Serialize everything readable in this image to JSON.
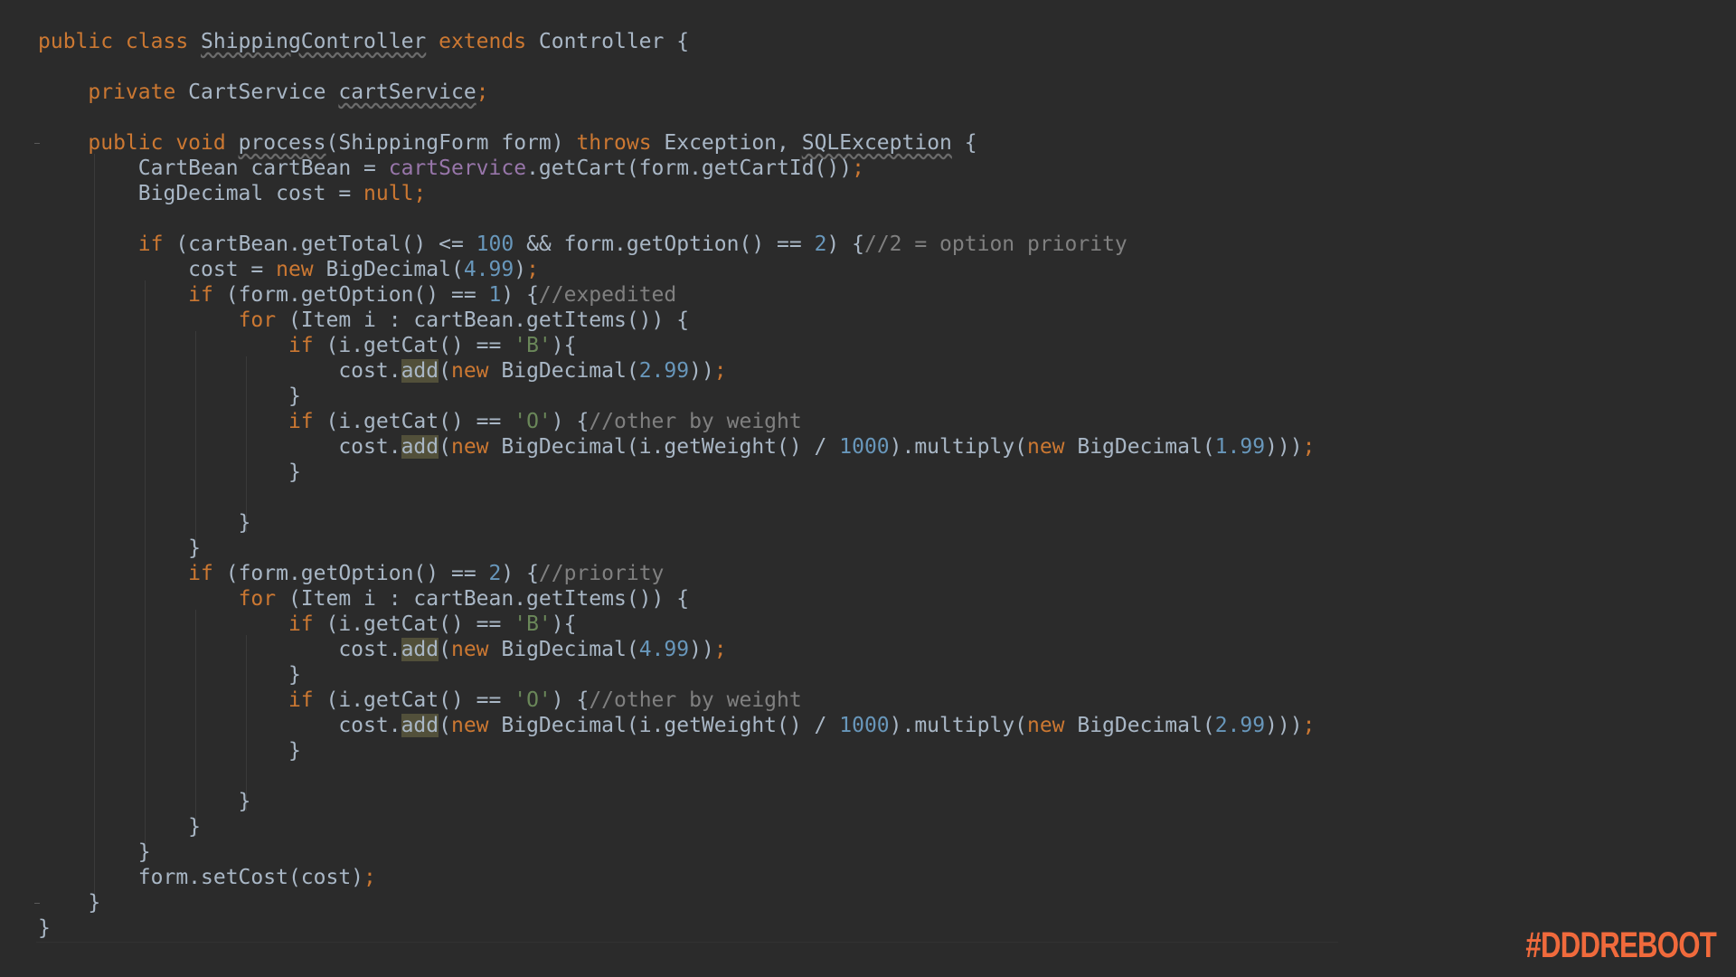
{
  "editor": {
    "lines": [
      [
        [
          "kw",
          "public class "
        ],
        [
          "dim",
          "ShippingController"
        ],
        [
          "kw",
          " extends "
        ],
        [
          "ty",
          "Controller {"
        ]
      ],
      [],
      [
        [
          "ty",
          "    "
        ],
        [
          "kw",
          "private "
        ],
        [
          "ty",
          "CartService "
        ],
        [
          "dim",
          "cartService"
        ],
        [
          "kw",
          ";"
        ]
      ],
      [],
      [
        [
          "ty",
          "    "
        ],
        [
          "kw",
          "public void "
        ],
        [
          "dim",
          "process"
        ],
        [
          "ty",
          "(ShippingForm form) "
        ],
        [
          "kw",
          "throws "
        ],
        [
          "ty",
          "Exception, "
        ],
        [
          "dim",
          "SQLException"
        ],
        [
          "ty",
          " {"
        ]
      ],
      [
        [
          "ty",
          "        CartBean cartBean = "
        ],
        [
          "fld",
          "cartService"
        ],
        [
          "ty",
          ".getCart(form.getCartId())"
        ],
        [
          "kw",
          ";"
        ]
      ],
      [
        [
          "ty",
          "        BigDecimal cost = "
        ],
        [
          "kw",
          "null;"
        ]
      ],
      [],
      [
        [
          "ty",
          "        "
        ],
        [
          "kw",
          "if "
        ],
        [
          "ty",
          "(cartBean.getTotal() <= "
        ],
        [
          "num",
          "100"
        ],
        [
          "ty",
          " && form.getOption() == "
        ],
        [
          "num",
          "2"
        ],
        [
          "ty",
          ") {"
        ],
        [
          "cm",
          "//2 = option priority"
        ]
      ],
      [
        [
          "ty",
          "            cost = "
        ],
        [
          "kw",
          "new "
        ],
        [
          "ty",
          "BigDecimal("
        ],
        [
          "num",
          "4.99"
        ],
        [
          "ty",
          ")"
        ],
        [
          "kw",
          ";"
        ]
      ],
      [
        [
          "ty",
          "            "
        ],
        [
          "kw",
          "if "
        ],
        [
          "ty",
          "(form.getOption() == "
        ],
        [
          "num",
          "1"
        ],
        [
          "ty",
          ") {"
        ],
        [
          "cm",
          "//expedited"
        ]
      ],
      [
        [
          "ty",
          "                "
        ],
        [
          "kw",
          "for "
        ],
        [
          "ty",
          "(Item i : cartBean.getItems()) {"
        ]
      ],
      [
        [
          "ty",
          "                    "
        ],
        [
          "kw",
          "if "
        ],
        [
          "ty",
          "(i.getCat() == "
        ],
        [
          "str",
          "'B'"
        ],
        [
          "ty",
          "){"
        ]
      ],
      [
        [
          "ty",
          "                        cost."
        ],
        [
          "hl",
          "add"
        ],
        [
          "ty",
          "("
        ],
        [
          "kw",
          "new "
        ],
        [
          "ty",
          "BigDecimal("
        ],
        [
          "num",
          "2.99"
        ],
        [
          "ty",
          "))"
        ],
        [
          "kw",
          ";"
        ]
      ],
      [
        [
          "ty",
          "                    }"
        ]
      ],
      [
        [
          "ty",
          "                    "
        ],
        [
          "kw",
          "if "
        ],
        [
          "ty",
          "(i.getCat() == "
        ],
        [
          "str",
          "'O'"
        ],
        [
          "ty",
          ") {"
        ],
        [
          "cm",
          "//other by weight"
        ]
      ],
      [
        [
          "ty",
          "                        cost."
        ],
        [
          "hl",
          "add"
        ],
        [
          "ty",
          "("
        ],
        [
          "kw",
          "new "
        ],
        [
          "ty",
          "BigDecimal(i.getWeight() / "
        ],
        [
          "num",
          "1000"
        ],
        [
          "ty",
          ").multiply("
        ],
        [
          "kw",
          "new "
        ],
        [
          "ty",
          "BigDecimal("
        ],
        [
          "num",
          "1.99"
        ],
        [
          "ty",
          ")))"
        ],
        [
          "kw",
          ";"
        ]
      ],
      [
        [
          "ty",
          "                    }"
        ]
      ],
      [],
      [
        [
          "ty",
          "                }"
        ]
      ],
      [
        [
          "ty",
          "            }"
        ]
      ],
      [
        [
          "ty",
          "            "
        ],
        [
          "kw",
          "if "
        ],
        [
          "ty",
          "(form.getOption() == "
        ],
        [
          "num",
          "2"
        ],
        [
          "ty",
          ") {"
        ],
        [
          "cm",
          "//priority"
        ]
      ],
      [
        [
          "ty",
          "                "
        ],
        [
          "kw",
          "for "
        ],
        [
          "ty",
          "(Item i : cartBean.getItems()) {"
        ]
      ],
      [
        [
          "ty",
          "                    "
        ],
        [
          "kw",
          "if "
        ],
        [
          "ty",
          "(i.getCat() == "
        ],
        [
          "str",
          "'B'"
        ],
        [
          "ty",
          "){"
        ]
      ],
      [
        [
          "ty",
          "                        cost."
        ],
        [
          "hl",
          "add"
        ],
        [
          "ty",
          "("
        ],
        [
          "kw",
          "new "
        ],
        [
          "ty",
          "BigDecimal("
        ],
        [
          "num",
          "4.99"
        ],
        [
          "ty",
          "))"
        ],
        [
          "kw",
          ";"
        ]
      ],
      [
        [
          "ty",
          "                    }"
        ]
      ],
      [
        [
          "ty",
          "                    "
        ],
        [
          "kw",
          "if "
        ],
        [
          "ty",
          "(i.getCat() == "
        ],
        [
          "str",
          "'O'"
        ],
        [
          "ty",
          ") {"
        ],
        [
          "cm",
          "//other by weight"
        ]
      ],
      [
        [
          "ty",
          "                        cost."
        ],
        [
          "hl",
          "add"
        ],
        [
          "ty",
          "("
        ],
        [
          "kw",
          "new "
        ],
        [
          "ty",
          "BigDecimal(i.getWeight() / "
        ],
        [
          "num",
          "1000"
        ],
        [
          "ty",
          ").multiply("
        ],
        [
          "kw",
          "new "
        ],
        [
          "ty",
          "BigDecimal("
        ],
        [
          "num",
          "2.99"
        ],
        [
          "ty",
          ")))"
        ],
        [
          "kw",
          ";"
        ]
      ],
      [
        [
          "ty",
          "                    }"
        ]
      ],
      [],
      [
        [
          "ty",
          "                }"
        ]
      ],
      [
        [
          "ty",
          "            }"
        ]
      ],
      [
        [
          "ty",
          "        }"
        ]
      ],
      [
        [
          "ty",
          "        form.setCost(cost)"
        ],
        [
          "kw",
          ";"
        ]
      ],
      [
        [
          "ty",
          "    }"
        ]
      ],
      [
        [
          "ty",
          "}"
        ]
      ]
    ]
  },
  "footer": {
    "hashtag": "#DDDREBOOT"
  },
  "colors": {
    "background": "#2b2b2b",
    "keyword": "#cc7832",
    "number": "#6897bb",
    "comment": "#808080",
    "string": "#6a8759",
    "field": "#9876aa",
    "text": "#a9b7c6",
    "highlight": "#52503a",
    "brand": "#f06a3c"
  }
}
